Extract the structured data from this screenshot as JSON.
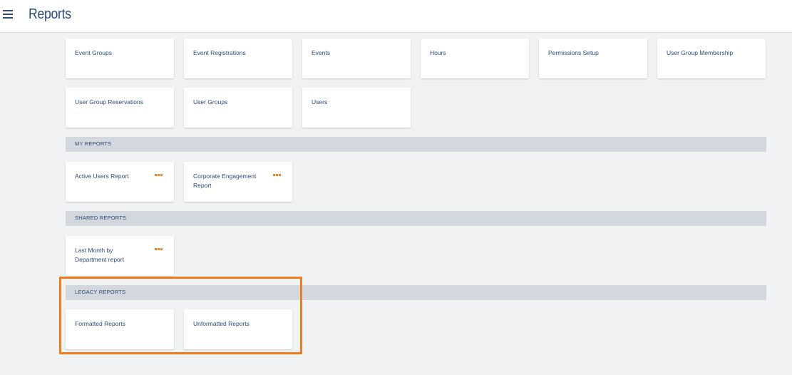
{
  "header": {
    "title": "Reports"
  },
  "tiles": [
    {
      "label": "Event Groups"
    },
    {
      "label": "Event Registrations"
    },
    {
      "label": "Events"
    },
    {
      "label": "Hours"
    },
    {
      "label": "Permissions Setup"
    },
    {
      "label": "User Group Membership"
    },
    {
      "label": "User Group Reservations"
    },
    {
      "label": "User Groups"
    },
    {
      "label": "Users"
    }
  ],
  "my_reports": {
    "title": "MY REPORTS",
    "items": [
      {
        "label": "Active Users Report"
      },
      {
        "label": "Corporate Engagement Report"
      }
    ]
  },
  "shared_reports": {
    "title": "SHARED REPORTS",
    "items": [
      {
        "label": "Last Month by Department report"
      }
    ]
  },
  "legacy_reports": {
    "title": "LEGACY REPORTS",
    "items": [
      {
        "label": "Formatted Reports"
      },
      {
        "label": "Unformatted Reports"
      }
    ]
  },
  "colors": {
    "accent": "#f07d1e",
    "text": "#2b4a7a",
    "section_bg": "#d2d8de",
    "page_bg": "#f1f2f4"
  },
  "icons": {
    "menu": "hamburger-icon",
    "tile_actions": "more-options-icon"
  }
}
